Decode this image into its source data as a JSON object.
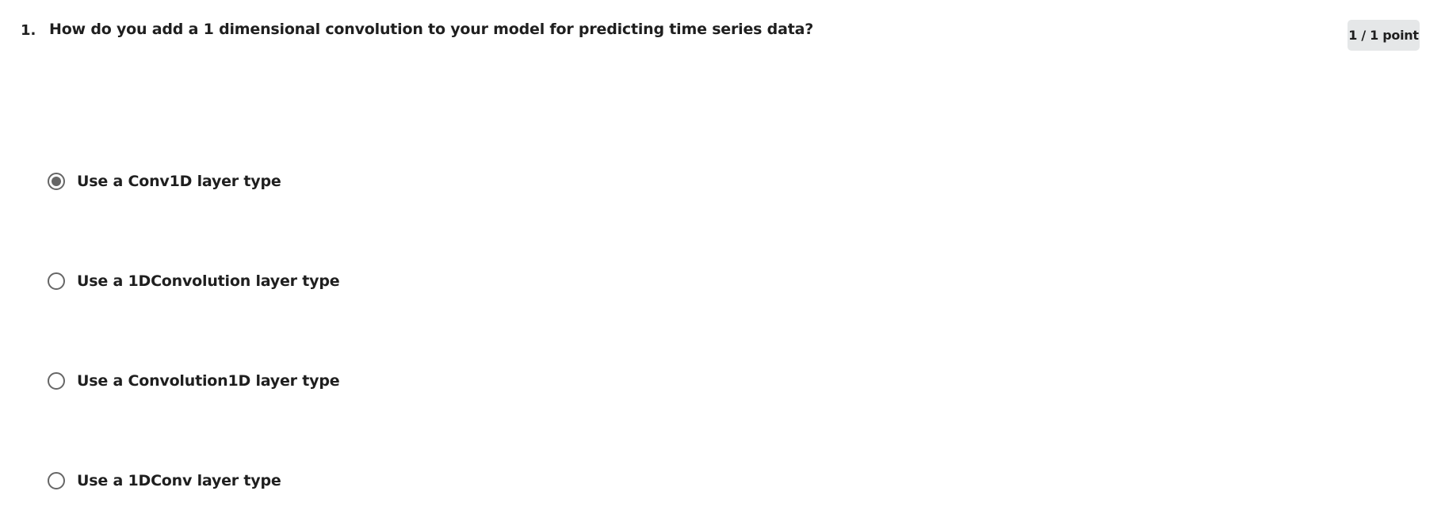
{
  "question": {
    "number": "1.",
    "text": "How do you add a 1 dimensional convolution to your model for predicting time series data?",
    "score": "1 / 1 point"
  },
  "options": [
    {
      "label": "Use a Conv1D layer type",
      "selected": true
    },
    {
      "label": "Use a 1DConvolution layer type",
      "selected": false
    },
    {
      "label": "Use a Convolution1D layer type",
      "selected": false
    },
    {
      "label": "Use a 1DConv layer type",
      "selected": false
    }
  ],
  "colors": {
    "radio": "#666666",
    "badge_bg": "#e5e7e8",
    "text": "#1f1f1f"
  }
}
